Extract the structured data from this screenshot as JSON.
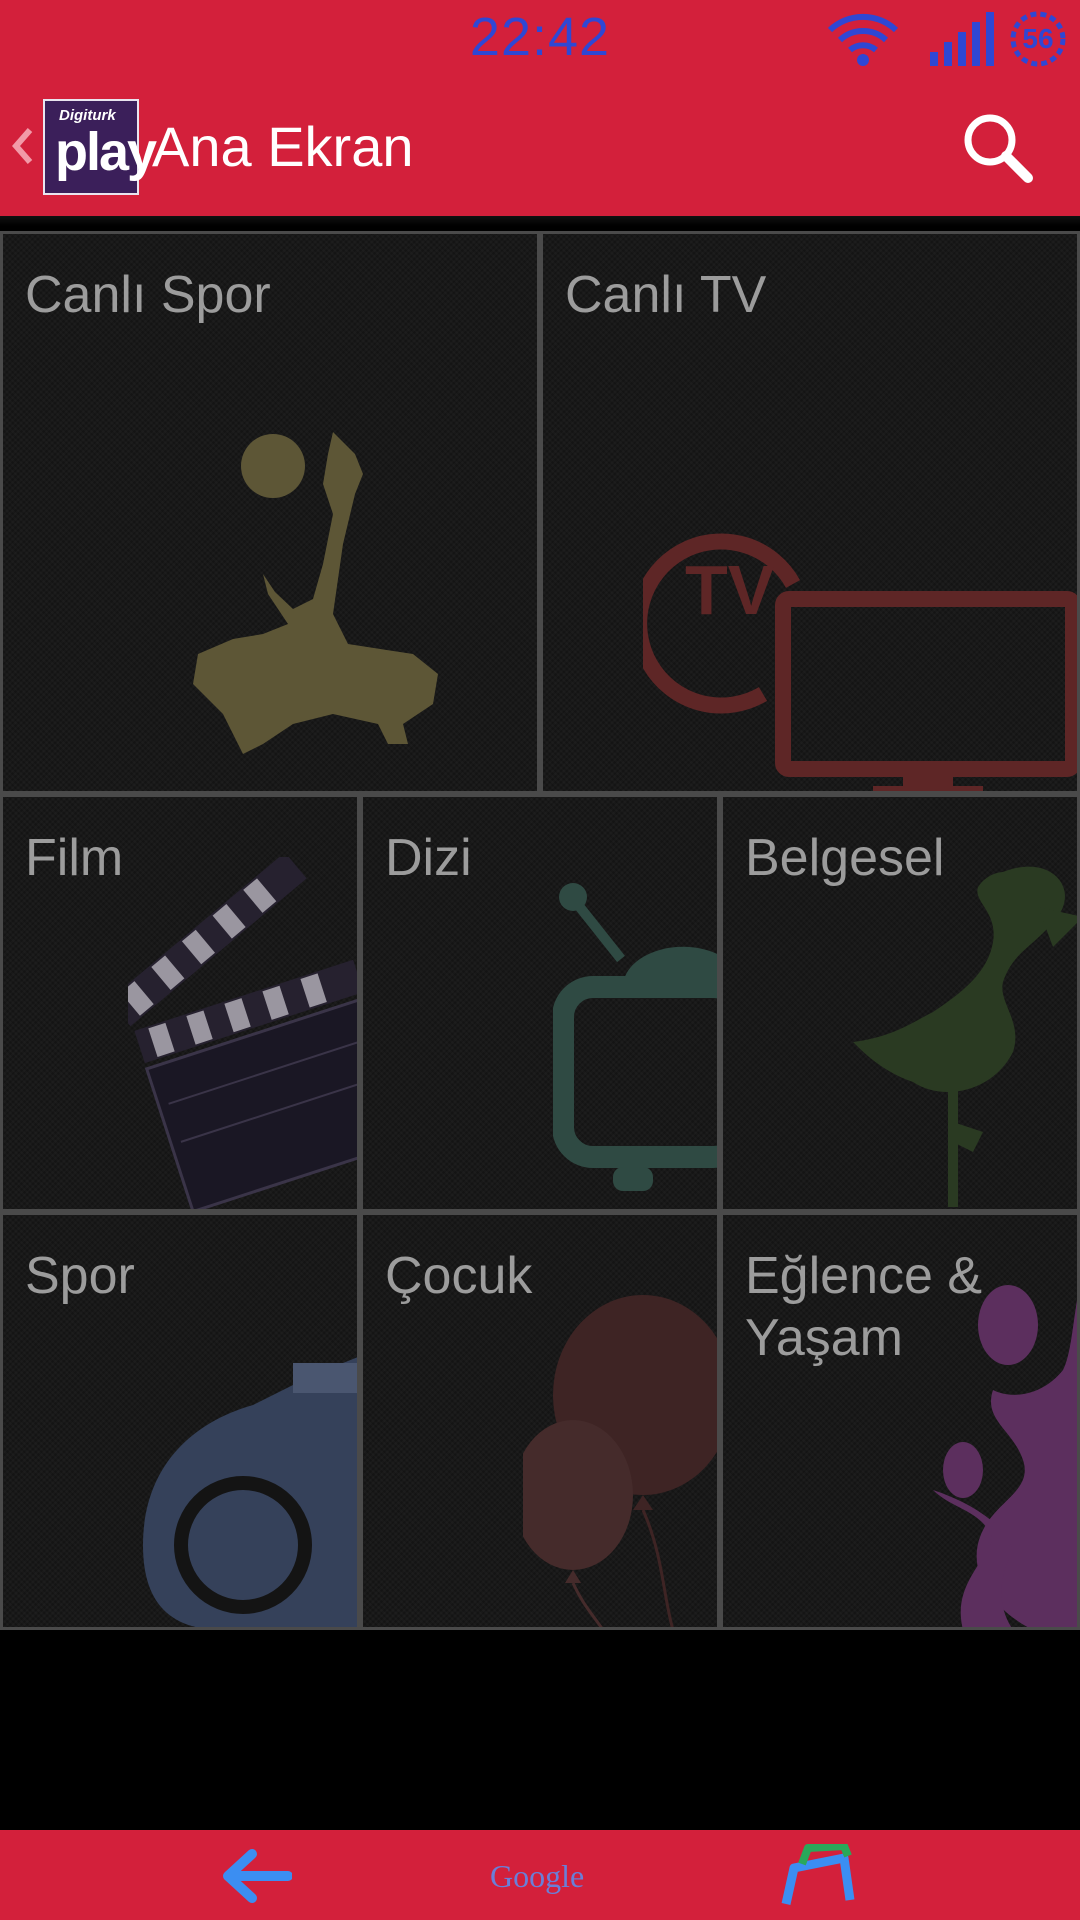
{
  "status_bar": {
    "time": "22:42",
    "battery_level": "56",
    "icons": [
      "wifi-icon",
      "signal-icon",
      "battery-circle-icon"
    ]
  },
  "action_bar": {
    "logo_small": "Digiturk",
    "logo_big": "play",
    "title": "Ana Ekran",
    "icons": [
      "chevron-left-icon",
      "search-icon"
    ]
  },
  "tiles": [
    {
      "label": "Canlı Spor",
      "icon": "footballer-kick-icon"
    },
    {
      "label": "Canlı TV",
      "icon": "live-tv-icon"
    },
    {
      "label": "Film",
      "icon": "clapperboard-icon"
    },
    {
      "label": "Dizi",
      "icon": "retro-tv-icon"
    },
    {
      "label": "Belgesel",
      "icon": "flamingo-icon"
    },
    {
      "label": "Spor",
      "icon": "whistle-icon"
    },
    {
      "label": "Çocuk",
      "icon": "balloons-icon"
    },
    {
      "label": "Eğlence &\nYaşam",
      "icon": "dancers-icon"
    }
  ],
  "nav_bar": {
    "google_label": "Google",
    "icons": [
      "back-arrow-icon",
      "recents-icon"
    ]
  },
  "colors": {
    "bar": "#d3203b",
    "status_text": "#2f47d4",
    "tile_border": "#4a4a4a",
    "tile_label": "#9c9c9c"
  }
}
